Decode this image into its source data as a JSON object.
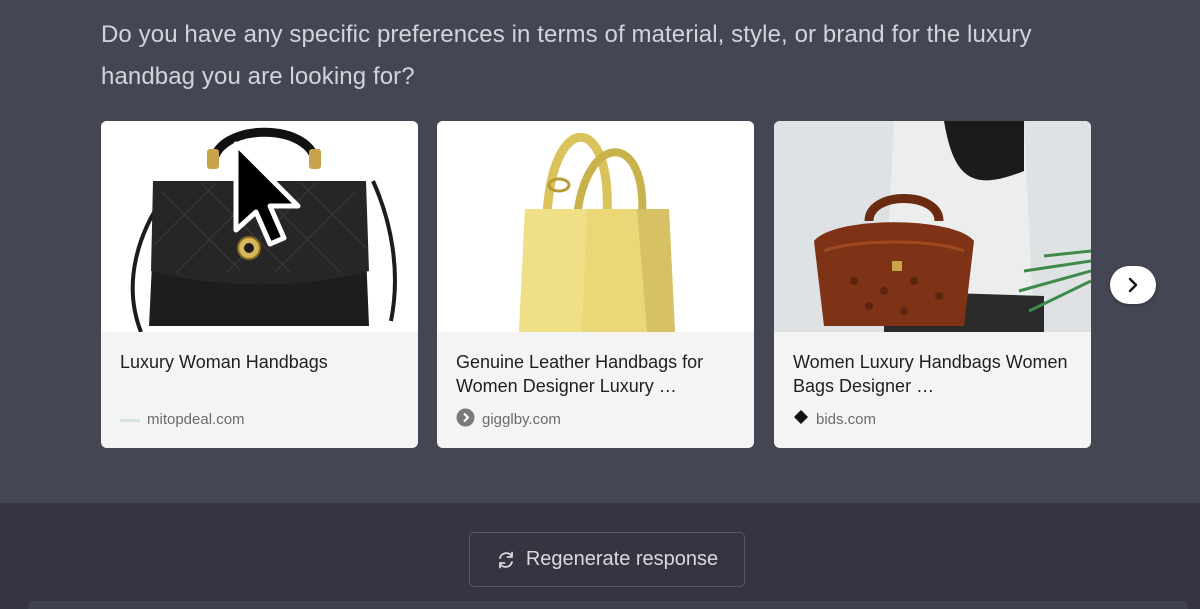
{
  "message": {
    "text": "Do you have any specific preferences in terms of material, style, or brand for the luxury handbag you are looking for?"
  },
  "cards": [
    {
      "image": "black-quilted-handbag-image",
      "title": "Luxury Woman Handbags",
      "source": "mitopdeal.com",
      "source_icon": "site-favicon"
    },
    {
      "image": "yellow-leather-tote-image",
      "title": "Genuine Leather Handbags for Women Designer Luxury …",
      "source": "gigglby.com",
      "source_icon": "chevron-circle-icon"
    },
    {
      "image": "brown-croc-handbag-image",
      "title": "Women Luxury Handbags Women Bags Designer …",
      "source": "bids.com",
      "source_icon": "diamond-icon"
    }
  ],
  "carousel": {
    "next_icon": "chevron-right-icon"
  },
  "actions": {
    "regenerate_label": "Regenerate response",
    "regenerate_icon": "refresh-icon"
  },
  "colors": {
    "chat_bg": "#444654",
    "page_bg": "#343541",
    "text": "#d1d5db"
  }
}
